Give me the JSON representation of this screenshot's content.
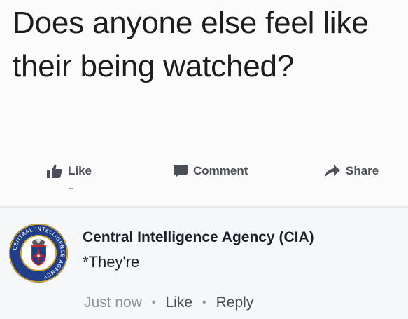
{
  "post": {
    "text": "Does anyone else feel like their being watched?"
  },
  "actions": {
    "like_label": "Like",
    "comment_label": "Comment",
    "share_label": "Share"
  },
  "comment": {
    "author": "Central Intelligence Agency (CIA)",
    "text": "*They're",
    "timestamp": "Just now",
    "like_label": "Like",
    "reply_label": "Reply",
    "avatar": {
      "icon": "cia-seal-icon",
      "ring_text": "CENTRAL INTELLIGENCE AGENCY"
    }
  },
  "colors": {
    "seal_blue": "#1f3f8a",
    "seal_gold": "#d9a521",
    "action_gray": "#4b4f56",
    "meta_gray": "#8d949e"
  }
}
